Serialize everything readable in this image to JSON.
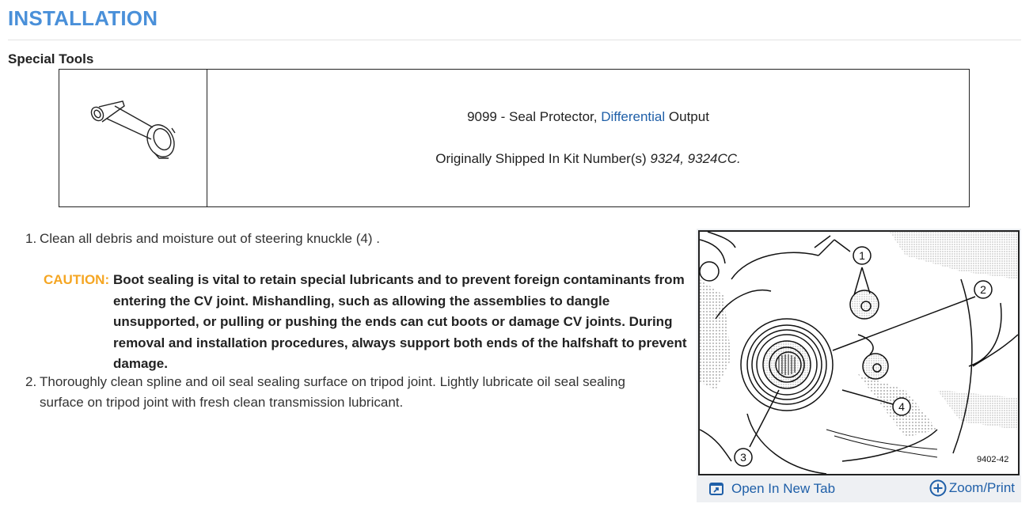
{
  "page": {
    "title": "INSTALLATION",
    "special_tools_heading": "Special Tools"
  },
  "special_tools": {
    "tool_number_prefix": "9099 - Seal Protector, ",
    "tool_link": "Differential",
    "tool_suffix": " Output",
    "kit_prefix": "Originally Shipped In Kit Number(s) ",
    "kit_numbers": "9324, 9324CC."
  },
  "steps": [
    {
      "number": "1.",
      "text": "Clean all debris and moisture out of steering knuckle (4) ."
    },
    {
      "number": "2.",
      "text": "Thoroughly clean spline and oil seal sealing surface on tripod joint. Lightly lubricate oil seal sealing surface on tripod joint with fresh clean transmission lubricant."
    }
  ],
  "caution": {
    "label": "CAUTION:",
    "text": "Boot sealing is vital to retain special lubricants and to prevent foreign contaminants from entering the CV joint. Mishandling, such as allowing the assemblies to dangle unsupported, or pulling or pushing the ends can cut boots or damage CV joints. During removal and installation procedures, always support both ends of the halfshaft to prevent damage."
  },
  "figure": {
    "callouts": [
      "1",
      "2",
      "3",
      "4"
    ],
    "code": "9402-42",
    "open_tab_label": "Open In New Tab",
    "zoom_label": "Zoom/Print",
    "open_tab_icon": "open-in-new-tab-icon",
    "zoom_icon": "plus-circle-icon"
  },
  "colors": {
    "title": "#4a90d9",
    "caution": "#f5a623",
    "link": "#1f5fa8"
  }
}
